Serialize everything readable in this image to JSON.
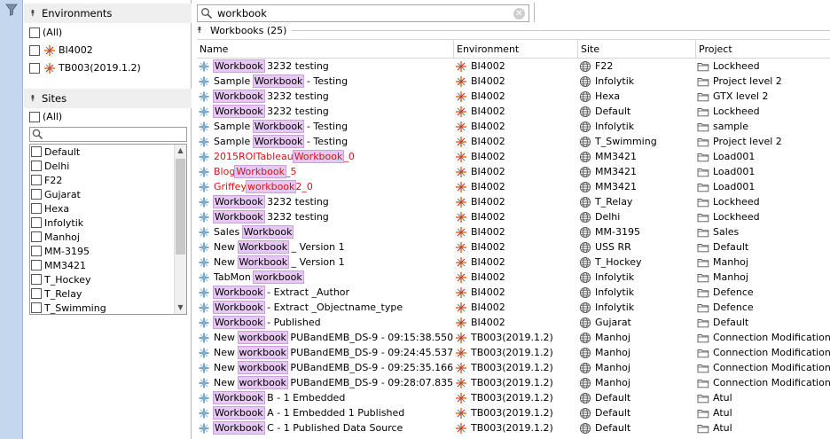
{
  "search": {
    "value": "workbook"
  },
  "environments": {
    "title": "Environments",
    "items": [
      {
        "label": "(All)"
      },
      {
        "label": "BI4002"
      },
      {
        "label": "TB003(2019.1.2)"
      }
    ]
  },
  "sites": {
    "title": "Sites",
    "all_label": "(All)",
    "items": [
      "Default",
      "Delhi",
      "F22",
      "Gujarat",
      "Hexa",
      "Infolytik",
      "Manhoj",
      "MM-3195",
      "MM3421",
      "T_Hockey",
      "T_Relay",
      "T_Swimming"
    ]
  },
  "workbooks": {
    "title": "Workbooks (25)",
    "columns": [
      "Name",
      "Environment",
      "Site",
      "Project"
    ],
    "rows": [
      {
        "name": [
          [
            "Workbook",
            1
          ],
          [
            " 3232 testing",
            0
          ]
        ],
        "env": "BI4002",
        "site": "F22",
        "project": "Lockheed",
        "red": false
      },
      {
        "name": [
          [
            "Sample ",
            0
          ],
          [
            "Workbook",
            1
          ],
          [
            " -  Testing",
            0
          ]
        ],
        "env": "BI4002",
        "site": "Infolytik",
        "project": "Project  level 2",
        "red": false
      },
      {
        "name": [
          [
            "Workbook",
            1
          ],
          [
            " 3232 testing",
            0
          ]
        ],
        "env": "BI4002",
        "site": "Hexa",
        "project": "GTX  level 2",
        "red": false
      },
      {
        "name": [
          [
            "Workbook",
            1
          ],
          [
            " 3232 testing",
            0
          ]
        ],
        "env": "BI4002",
        "site": "Default",
        "project": "Lockheed",
        "red": false
      },
      {
        "name": [
          [
            "Sample ",
            0
          ],
          [
            "Workbook",
            1
          ],
          [
            " -  Testing",
            0
          ]
        ],
        "env": "BI4002",
        "site": "Infolytik",
        "project": "sample",
        "red": false
      },
      {
        "name": [
          [
            "Sample ",
            0
          ],
          [
            "Workbook",
            1
          ],
          [
            " -  Testing",
            0
          ]
        ],
        "env": "BI4002",
        "site": "T_Swimming",
        "project": "Project  level 2",
        "red": false
      },
      {
        "name": [
          [
            "2015ROITableau",
            0
          ],
          [
            "Workbook",
            1
          ],
          [
            "_0",
            0
          ]
        ],
        "env": "BI4002",
        "site": "MM3421",
        "project": "Load001",
        "red": true
      },
      {
        "name": [
          [
            "Blog",
            0
          ],
          [
            "Workbook",
            1
          ],
          [
            "_5",
            0
          ]
        ],
        "env": "BI4002",
        "site": "MM3421",
        "project": "Load001",
        "red": true
      },
      {
        "name": [
          [
            "Griffey",
            0
          ],
          [
            "workbook",
            1
          ],
          [
            "2_0",
            0
          ]
        ],
        "env": "BI4002",
        "site": "MM3421",
        "project": "Load001",
        "red": true
      },
      {
        "name": [
          [
            "Workbook",
            1
          ],
          [
            " 3232 testing",
            0
          ]
        ],
        "env": "BI4002",
        "site": "T_Relay",
        "project": "Lockheed",
        "red": false
      },
      {
        "name": [
          [
            "Workbook",
            1
          ],
          [
            " 3232 testing",
            0
          ]
        ],
        "env": "BI4002",
        "site": "Delhi",
        "project": "Lockheed",
        "red": false
      },
      {
        "name": [
          [
            "Sales ",
            0
          ],
          [
            "Workbook",
            1
          ]
        ],
        "env": "BI4002",
        "site": "MM-3195",
        "project": "Sales",
        "red": false
      },
      {
        "name": [
          [
            "New ",
            0
          ],
          [
            "Workbook",
            1
          ],
          [
            " _ Version 1",
            0
          ]
        ],
        "env": "BI4002",
        "site": "USS RR",
        "project": "Default",
        "red": false
      },
      {
        "name": [
          [
            "New ",
            0
          ],
          [
            "Workbook",
            1
          ],
          [
            " _ Version 1",
            0
          ]
        ],
        "env": "BI4002",
        "site": "T_Hockey",
        "project": "Manhoj",
        "red": false
      },
      {
        "name": [
          [
            "TabMon ",
            0
          ],
          [
            "workbook",
            1
          ]
        ],
        "env": "BI4002",
        "site": "Infolytik",
        "project": "Manhoj",
        "red": false
      },
      {
        "name": [
          [
            "Workbook",
            1
          ],
          [
            " - Extract _Author",
            0
          ]
        ],
        "env": "BI4002",
        "site": "Infolytik",
        "project": "Defence",
        "red": false
      },
      {
        "name": [
          [
            "Workbook",
            1
          ],
          [
            " - Extract _Objectname_type",
            0
          ]
        ],
        "env": "BI4002",
        "site": "Infolytik",
        "project": "Defence",
        "red": false
      },
      {
        "name": [
          [
            "Workbook",
            1
          ],
          [
            " - Published",
            0
          ]
        ],
        "env": "BI4002",
        "site": "Gujarat",
        "project": "Default",
        "red": false
      },
      {
        "name": [
          [
            "New ",
            0
          ],
          [
            "workbook",
            1
          ],
          [
            " PUBandEMB_DS-9 - 09:15:38.550",
            0
          ]
        ],
        "env": "TB003(2019.1.2)",
        "site": "Manhoj",
        "project": "Connection Modification",
        "red": false
      },
      {
        "name": [
          [
            "New ",
            0
          ],
          [
            "workbook",
            1
          ],
          [
            " PUBandEMB_DS-9 - 09:24:45.537",
            0
          ]
        ],
        "env": "TB003(2019.1.2)",
        "site": "Manhoj",
        "project": "Connection Modification",
        "red": false
      },
      {
        "name": [
          [
            "New ",
            0
          ],
          [
            "workbook",
            1
          ],
          [
            " PUBandEMB_DS-9 - 09:25:35.166",
            0
          ]
        ],
        "env": "TB003(2019.1.2)",
        "site": "Manhoj",
        "project": "Connection Modification",
        "red": false
      },
      {
        "name": [
          [
            "New ",
            0
          ],
          [
            "workbook",
            1
          ],
          [
            " PUBandEMB_DS-9 - 09:28:07.835",
            0
          ]
        ],
        "env": "TB003(2019.1.2)",
        "site": "Manhoj",
        "project": "Connection Modification",
        "red": false
      },
      {
        "name": [
          [
            "Workbook",
            1
          ],
          [
            " B - 1 Embedded",
            0
          ]
        ],
        "env": "TB003(2019.1.2)",
        "site": "Default",
        "project": "Atul",
        "red": false
      },
      {
        "name": [
          [
            "Workbook",
            1
          ],
          [
            " A - 1 Embedded 1 Published",
            0
          ]
        ],
        "env": "TB003(2019.1.2)",
        "site": "Default",
        "project": "Atul",
        "red": false
      },
      {
        "name": [
          [
            "Workbook",
            1
          ],
          [
            " C - 1 Published Data Source",
            0
          ]
        ],
        "env": "TB003(2019.1.2)",
        "site": "Default",
        "project": "Atul",
        "red": false
      }
    ]
  },
  "colors": {
    "highlight": "#e6c8f3",
    "red_text": "#d01717",
    "strip": "#c4d7ee"
  },
  "icons": {
    "filter": "filter-icon",
    "environment": "tableau-logo-icon",
    "site": "globe-icon",
    "project": "folder-icon",
    "workbook": "workbook-icon",
    "search": "search-icon"
  }
}
